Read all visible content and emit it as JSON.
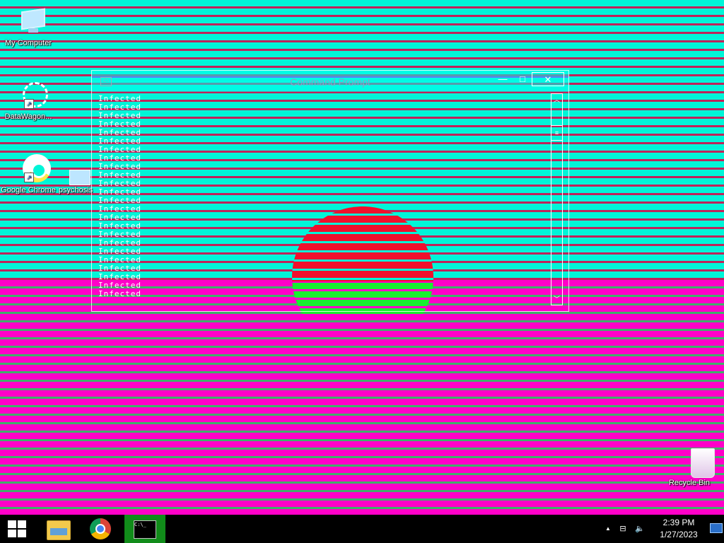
{
  "desktop": {
    "icons": [
      {
        "label": "My Computer",
        "icon": "monitor-icon"
      },
      {
        "label": "DataWagon...",
        "icon": "gear-shortcut-icon"
      },
      {
        "label": "Google Chrome",
        "icon": "chrome-icon"
      },
      {
        "label": "psychosis",
        "icon": "psychosis-icon"
      },
      {
        "label": "Recycle Bin",
        "icon": "recycle-bin-icon"
      }
    ],
    "colors": {
      "upper_band": "#00f5d8",
      "upper_line": "#c0225a",
      "lower_band": "#ff00c8",
      "lower_line": "#3fb06a",
      "circle_red": "#f0102c",
      "circle_green": "#18f030"
    }
  },
  "cmd_window": {
    "title": "Command Prompt",
    "icon_label": "C:\\",
    "minimize_symbol": "—",
    "maximize_symbol": "□",
    "close_symbol": "✕",
    "output_lines": [
      "Infected",
      "Infected",
      "Infected",
      "Infected",
      "Infected",
      "Infected",
      "Infected",
      "Infected",
      "Infected",
      "Infected",
      "Infected",
      "Infected",
      "Infected",
      "Infected",
      "Infected",
      "Infected",
      "Infected",
      "Infected",
      "Infected",
      "Infected",
      "Infected",
      "Infected",
      "Infected",
      "Infected"
    ],
    "scroll_up_symbol": "︿",
    "scroll_down_symbol": "﹀",
    "scroll_thumb_symbol": "≡"
  },
  "taskbar": {
    "start_icon": "windows-logo-icon",
    "pinned": [
      {
        "name": "File Explorer",
        "icon": "folder-icon"
      },
      {
        "name": "Google Chrome",
        "icon": "chrome-icon"
      },
      {
        "name": "Command Prompt",
        "icon": "cmd-icon",
        "active": true,
        "active_color": "#118c1a"
      }
    ],
    "cmd_icon_text": "C:\\_",
    "tray": {
      "chevron_symbol": "▲",
      "network_symbol": "⊟",
      "volume_symbol": "🔈",
      "time": "2:39 PM",
      "date": "1/27/2023"
    }
  }
}
